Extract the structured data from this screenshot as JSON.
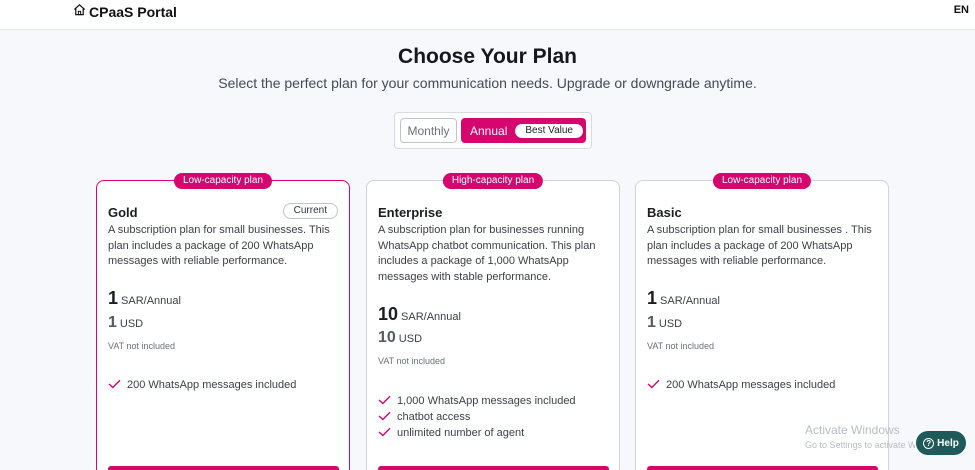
{
  "header": {
    "brand": "CPaaS Portal",
    "language": "EN"
  },
  "page": {
    "title": "Choose Your Plan",
    "subtitle": "Select the perfect plan for your communication needs. Upgrade or downgrade anytime."
  },
  "billing_toggle": {
    "monthly": "Monthly",
    "annual": "Annual",
    "best_value": "Best Value",
    "selected": "Annual"
  },
  "accent_color": "#d6066f",
  "plans": [
    {
      "badge": "Low-capacity plan",
      "name": "Gold",
      "status": "Current",
      "description": "A subscription plan for small businesses. This plan includes a package of 200 WhatsApp messages with reliable performance.",
      "price": "1",
      "price_unit": "SAR/Annual",
      "price_usd": "1",
      "usd_unit": "USD",
      "vat": "VAT not included",
      "features": [
        "200 WhatsApp messages included"
      ]
    },
    {
      "badge": "High-capacity plan",
      "name": "Enterprise",
      "description": "A subscription plan for businesses running WhatsApp chatbot communication. This plan includes a package of 1,000 WhatsApp messages with stable performance.",
      "price": "10",
      "price_unit": "SAR/Annual",
      "price_usd": "10",
      "usd_unit": "USD",
      "vat": "VAT not included",
      "features": [
        "1,000 WhatsApp messages included",
        "chatbot access",
        "unlimited number of agent"
      ]
    },
    {
      "badge": "Low-capacity plan",
      "name": "Basic",
      "description": "A subscription plan for small businesses . This plan includes a package of 200 WhatsApp messages with reliable performance.",
      "price": "1",
      "price_unit": "SAR/Annual",
      "price_usd": "1",
      "usd_unit": "USD",
      "vat": "VAT not included",
      "features": [
        "200 WhatsApp messages included"
      ]
    }
  ],
  "overlay": {
    "activate_title": "Activate Windows",
    "activate_sub": "Go to Settings to activate Windows.",
    "help": "Help"
  }
}
